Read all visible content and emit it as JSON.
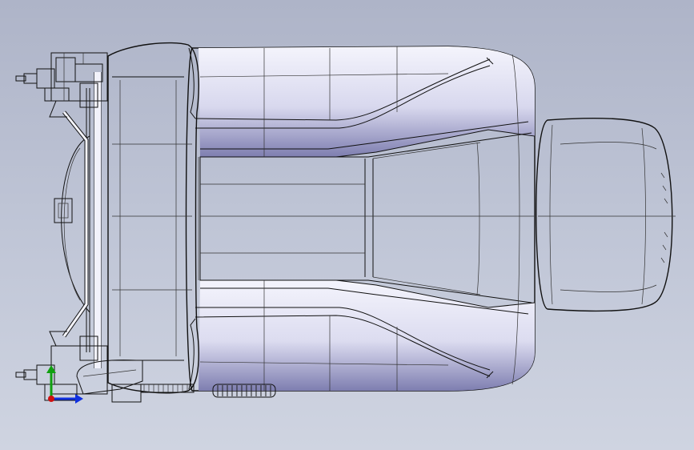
{
  "viewport": {
    "background_top": "#aeb4c8",
    "background_bottom": "#cfd4e1",
    "body_color": "#e9e9f6",
    "body_shade": "#8f8fb8",
    "headrest_color": "#f6f7c8",
    "headrest_shade": "#d9db8a",
    "outline_color": "#111111"
  },
  "model": {
    "parts": [
      "seat-cushion",
      "headrest",
      "rear-frame",
      "adjustment-knob",
      "motor-left",
      "motor-right"
    ]
  },
  "triad": {
    "axes": [
      {
        "name": "x",
        "color": "#d01010"
      },
      {
        "name": "y",
        "color": "#10a010"
      },
      {
        "name": "z",
        "color": "#1030e0"
      }
    ]
  }
}
